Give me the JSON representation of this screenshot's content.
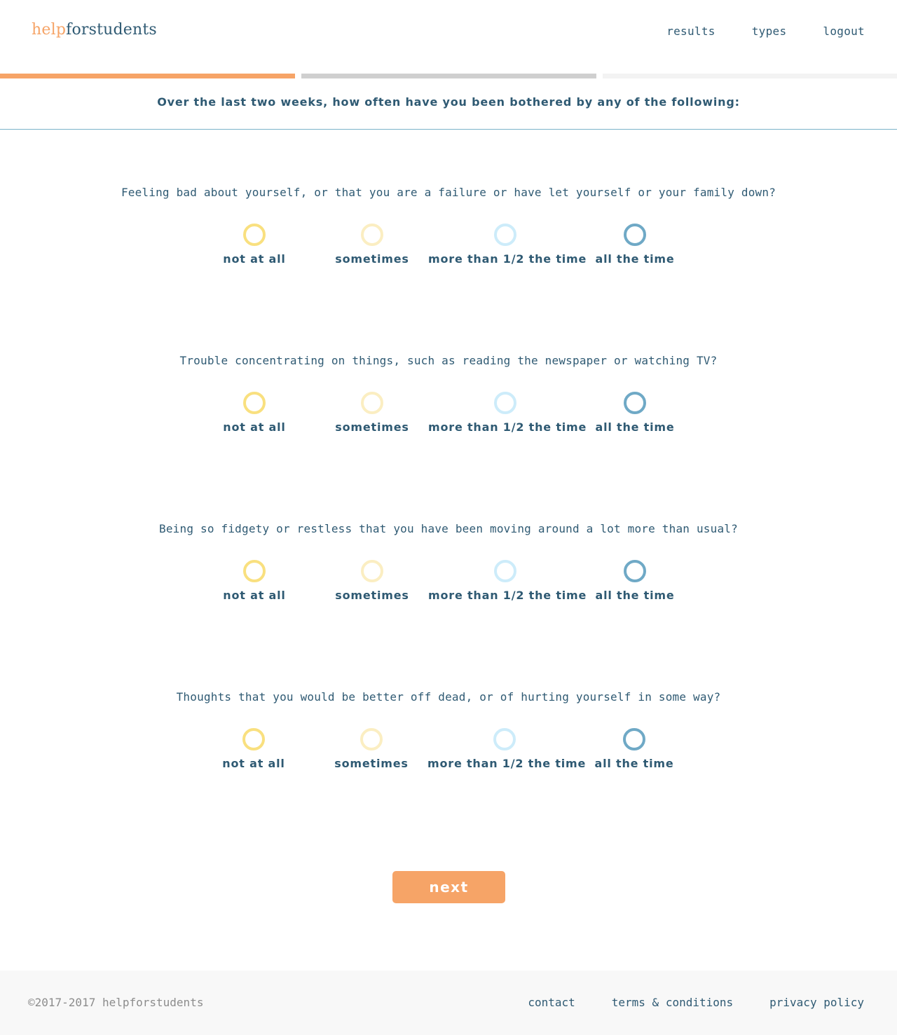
{
  "header": {
    "logo_part1": "help",
    "logo_part2": "forstudents",
    "nav": [
      "results",
      "types",
      "logout"
    ]
  },
  "progress": {
    "completed_steps": 1,
    "total_steps": 3,
    "colors": [
      "#f6a467",
      "#cfcfcf",
      "#f3f3f3"
    ]
  },
  "instruction": "Over the last two weeks, how often have you been bothered by any of the following:",
  "options": [
    {
      "label": "not at all",
      "color": "#f9e07f"
    },
    {
      "label": "sometimes",
      "color": "#fbeec2"
    },
    {
      "label": "more than 1/2 the time",
      "color": "#cdecfa"
    },
    {
      "label": "all the time",
      "color": "#6fa9c6"
    }
  ],
  "questions": [
    {
      "text": "Feeling bad about yourself, or that you are a failure or have let yourself or your family down?"
    },
    {
      "text": "Trouble concentrating on things, such as reading the newspaper or watching TV?"
    },
    {
      "text": "Being so fidgety or restless that you have been moving around a lot more than usual?"
    },
    {
      "text": "Thoughts that you would be better off dead, or of hurting yourself in some way?"
    }
  ],
  "next_label": "next",
  "footer": {
    "copyright": "©2017-2017 helpforstudents",
    "links": [
      "contact",
      "terms & conditions",
      "privacy policy"
    ]
  }
}
